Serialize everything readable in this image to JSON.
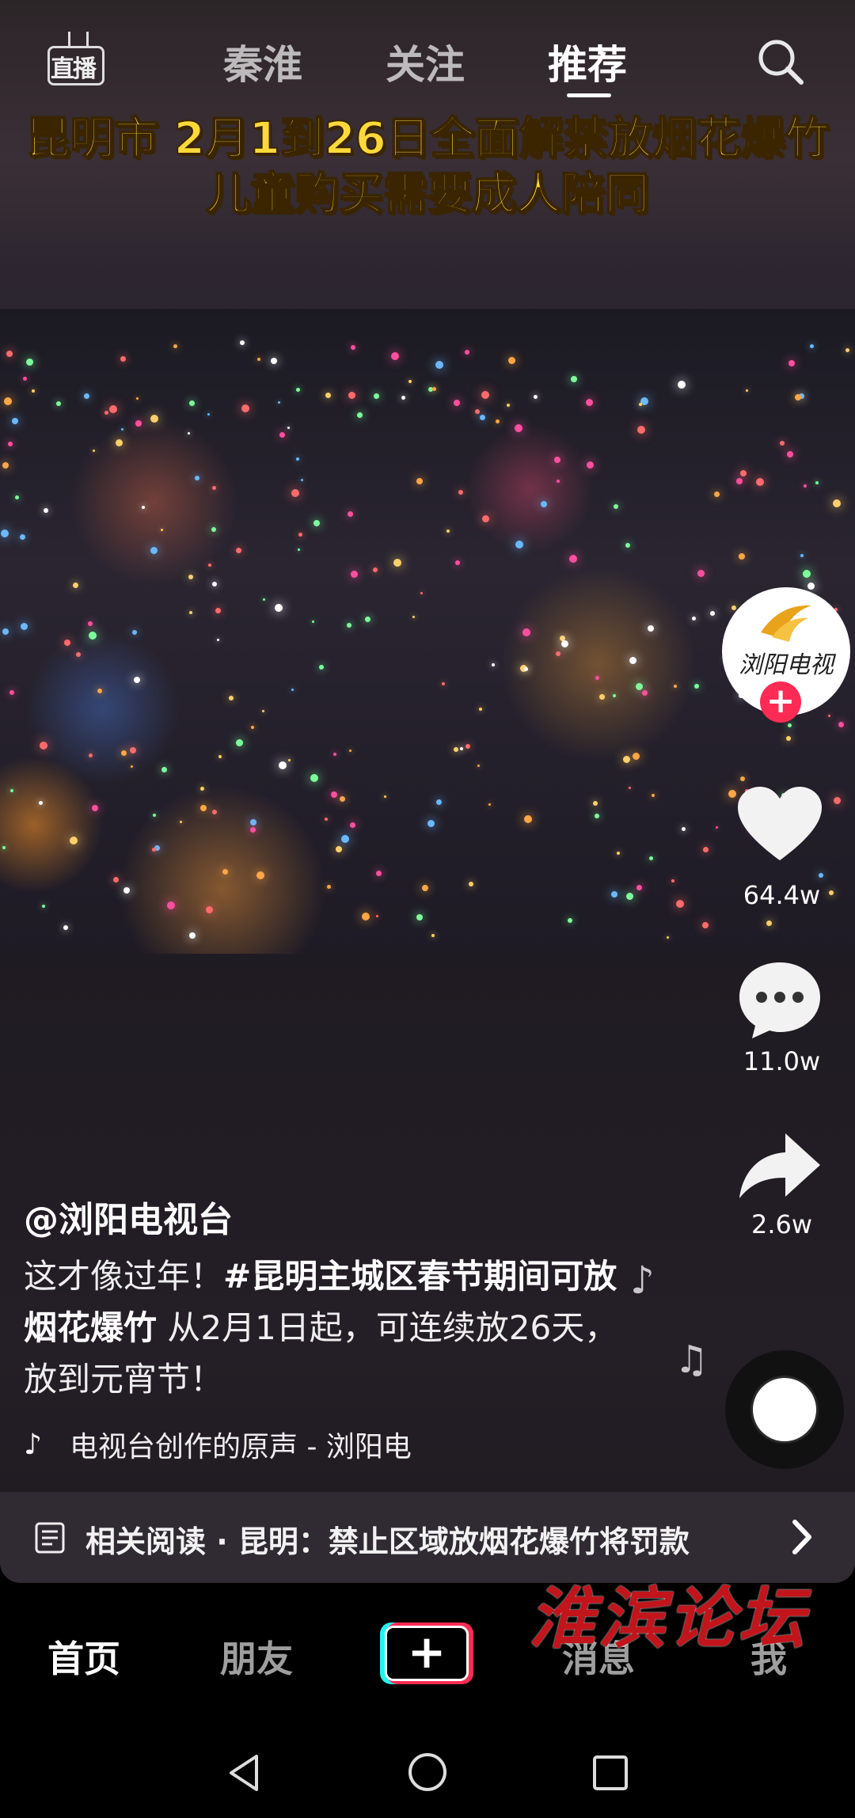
{
  "top_tabs": {
    "live_label": "直播",
    "items": [
      "秦淮",
      "关注",
      "推荐"
    ],
    "active": "推荐"
  },
  "video": {
    "caption_line1": "昆明市 2月1到26日全面解禁放烟花爆竹",
    "caption_line2": "儿童购买需要成人陪同"
  },
  "creator": {
    "avatar_text": "浏阳电视台",
    "follow_symbol": "+"
  },
  "actions": {
    "likes": "64.4w",
    "comments": "11.0w",
    "shares": "2.6w"
  },
  "post": {
    "author": "@浏阳电视台",
    "desc_part1": "这才像过年！",
    "hashtag": "#昆明主城区春节期间可放烟花爆竹",
    "desc_part2": " 从2月1日起，可连续放26天，放到元宵节！",
    "music": "电视台创作的原声 - 浏阳电"
  },
  "related": {
    "label": "相关阅读 · 昆明：禁止区域放烟花爆竹将罚款"
  },
  "bottom_tabs": {
    "home": "首页",
    "friends": "朋友",
    "plus": "+",
    "messages": "消息",
    "me": "我",
    "active": "首页"
  },
  "watermark": "淮滨论坛",
  "colors": {
    "accent_red": "#fe2c55",
    "accent_cyan": "#25f4ee",
    "caption_yellow": "#ffd93a",
    "watermark_red": "#c2141b"
  },
  "icons": [
    "live-icon",
    "search-icon",
    "heart-icon",
    "comment-icon",
    "share-icon",
    "music-note-icon",
    "document-icon",
    "chevron-right-icon",
    "back-icon",
    "home-circle-icon",
    "recents-square-icon"
  ]
}
